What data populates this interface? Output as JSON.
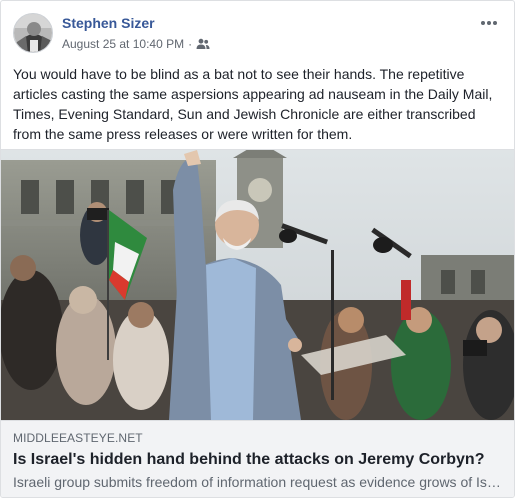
{
  "post": {
    "author": "Stephen Sizer",
    "timestamp": "August 25 at 10:40 PM",
    "separator": "·",
    "audience_icon": "friends-icon",
    "more_icon": "more-options-icon",
    "text": "You would have to be blind as a bat not to see their hands. The repetitive articles casting the same aspersions appearing ad nauseam in the Daily Mail, Times, Evening Standard, Sun and Jewish Chronicle are either transcribed from the same press releases or were written for them."
  },
  "link_preview": {
    "domain": "MIDDLEEASTEYE.NET",
    "title": "Is Israel's hidden hand behind the attacks on Jeremy Corbyn?",
    "description": "Israeli group submits freedom of information request as evidence grows of Israeli role in anti-Corbyn campaign"
  },
  "colors": {
    "author_link": "#385898",
    "secondary_text": "#616770",
    "card_background": "#f2f3f5",
    "border": "#dddfe2"
  }
}
